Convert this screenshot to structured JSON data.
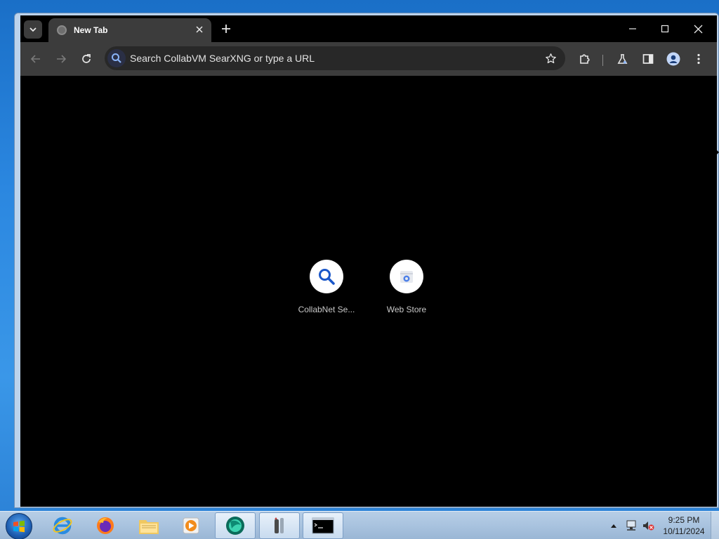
{
  "browser": {
    "tab": {
      "title": "New Tab"
    },
    "omnibox": {
      "placeholder": "Search CollabVM SearXNG or type a URL"
    }
  },
  "shortcuts": [
    {
      "label": "CollabNet Se...",
      "icon": "magnifier-icon"
    },
    {
      "label": "Web Store",
      "icon": "web-store-icon"
    }
  ],
  "taskbar": {
    "apps": [
      "internet-explorer",
      "firefox",
      "file-explorer",
      "media-player",
      "browser-active",
      "utility-tool",
      "command-prompt"
    ],
    "clock": {
      "time": "9:25 PM",
      "date": "10/11/2024"
    }
  },
  "colors": {
    "accent": "#8ab4f8",
    "toolbar": "#3c3c3c",
    "content_bg": "#000000"
  }
}
